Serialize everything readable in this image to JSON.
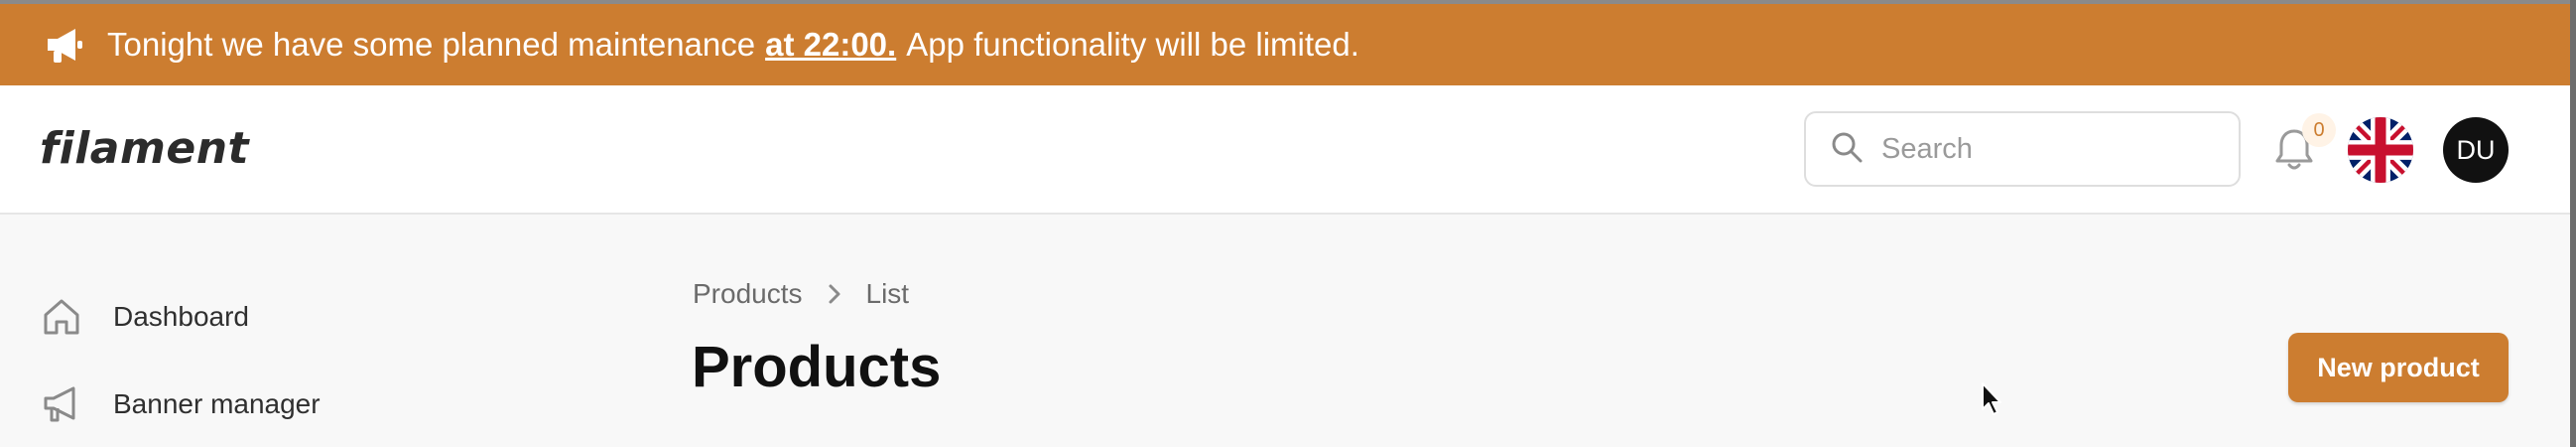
{
  "banner": {
    "text_before": "Tonight we have some planned maintenance",
    "emphasis": "at 22:00.",
    "text_after": "App functionality will be limited.",
    "icon": "megaphone-icon",
    "color": "#cc7d30"
  },
  "header": {
    "logo": "filament",
    "search": {
      "placeholder": "Search",
      "value": ""
    },
    "notifications": {
      "count": "0",
      "icon": "bell-icon"
    },
    "language": {
      "icon": "uk-flag-icon"
    },
    "user": {
      "initials": "DU"
    }
  },
  "sidebar": {
    "items": [
      {
        "label": "Dashboard",
        "icon": "home-icon"
      },
      {
        "label": "Banner manager",
        "icon": "megaphone-outline-icon"
      }
    ]
  },
  "main": {
    "breadcrumbs": [
      "Products",
      "List"
    ],
    "title": "Products",
    "new_button": "New product"
  },
  "colors": {
    "accent": "#cc7d30",
    "header_bg": "#ffffff",
    "page_bg": "#f8f8f8"
  }
}
